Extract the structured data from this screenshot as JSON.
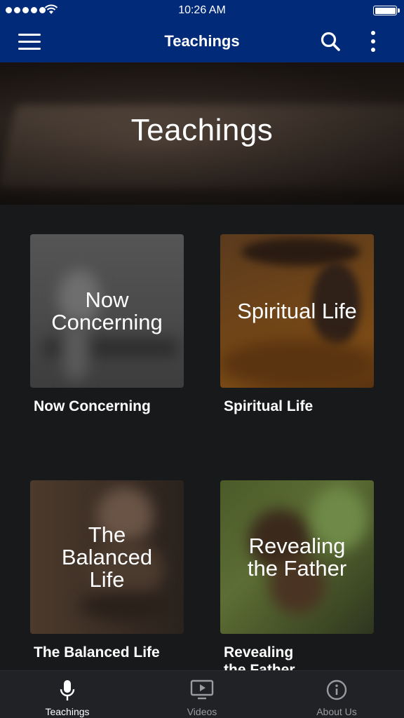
{
  "status_bar": {
    "time": "10:26 AM"
  },
  "nav": {
    "title": "Teachings"
  },
  "hero": {
    "title": "Teachings"
  },
  "cards": [
    {
      "overlay": "Now\nConcerning",
      "label": "Now Concerning"
    },
    {
      "overlay": "Spiritual Life",
      "label": "Spiritual Life"
    },
    {
      "overlay": "The\nBalanced\nLife",
      "label": "The Balanced Life"
    },
    {
      "overlay": "Revealing\nthe Father",
      "label": "Revealing\nthe Father"
    }
  ],
  "tabs": [
    {
      "label": "Teachings",
      "icon": "microphone-icon",
      "active": true
    },
    {
      "label": "Videos",
      "icon": "video-player-icon",
      "active": false
    },
    {
      "label": "About Us",
      "icon": "info-icon",
      "active": false
    }
  ],
  "colors": {
    "header": "#012a78",
    "background": "#18191b",
    "tab_bar": "#212226",
    "inactive_tab": "#9a9ba0"
  }
}
